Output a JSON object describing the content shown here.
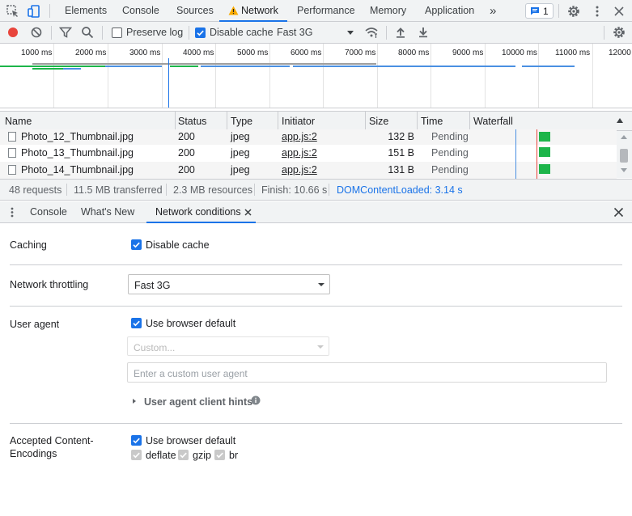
{
  "main_tabs": [
    {
      "label": "Elements"
    },
    {
      "label": "Console"
    },
    {
      "label": "Sources"
    },
    {
      "label": "Network",
      "active": true,
      "warning": true
    },
    {
      "label": "Performance"
    },
    {
      "label": "Memory"
    },
    {
      "label": "Application"
    }
  ],
  "more_tabs_glyph": "»",
  "issues_count": "1",
  "toolbar": {
    "preserve_log_label": "Preserve log",
    "preserve_log_checked": false,
    "disable_cache_label": "Disable cache",
    "disable_cache_checked": true,
    "throttling_value": "Fast 3G"
  },
  "overview": {
    "ticks": [
      "1000 ms",
      "2000 ms",
      "3000 ms",
      "4000 ms",
      "5000 ms",
      "6000 ms",
      "7000 ms",
      "8000 ms",
      "9000 ms",
      "10000 ms",
      "11000 ms",
      "12000"
    ]
  },
  "table": {
    "columns": [
      "Name",
      "Status",
      "Type",
      "Initiator",
      "Size",
      "Time",
      "Waterfall"
    ],
    "sorted_by": "Waterfall",
    "rows": [
      {
        "name": "Photo_12_Thumbnail.jpg",
        "status": "200",
        "type": "jpeg",
        "initiator": "app.js:2",
        "size": "132 B",
        "time": "Pending"
      },
      {
        "name": "Photo_13_Thumbnail.jpg",
        "status": "200",
        "type": "jpeg",
        "initiator": "app.js:2",
        "size": "151 B",
        "time": "Pending"
      },
      {
        "name": "Photo_14_Thumbnail.jpg",
        "status": "200",
        "type": "jpeg",
        "initiator": "app.js:2",
        "size": "131 B",
        "time": "Pending"
      }
    ]
  },
  "summary": {
    "requests": "48 requests",
    "transferred": "11.5 MB transferred",
    "resources": "2.3 MB resources",
    "finish": "Finish: 10.66 s",
    "dom_content_loaded": "DOMContentLoaded: 3.14 s",
    "dcl_color": "#1a73e8"
  },
  "drawer": {
    "tabs": [
      {
        "label": "Console"
      },
      {
        "label": "What's New"
      },
      {
        "label": "Network conditions",
        "active": true,
        "closable": true
      }
    ]
  },
  "network_conditions": {
    "caching_label": "Caching",
    "disable_cache_label": "Disable cache",
    "disable_cache_checked": true,
    "throttling_label": "Network throttling",
    "throttling_value": "Fast 3G",
    "user_agent_label": "User agent",
    "use_browser_default_label": "Use browser default",
    "use_browser_default_checked": true,
    "custom_select_value": "Custom...",
    "custom_ua_placeholder": "Enter a custom user agent",
    "ua_client_hints_label": "User agent client hints",
    "accepted_encodings_label_line1": "Accepted Content-",
    "accepted_encodings_label_line2": "Encodings",
    "encodings_default_label": "Use browser default",
    "encodings_default_checked": true,
    "encodings": [
      {
        "label": "deflate",
        "checked": true
      },
      {
        "label": "gzip",
        "checked": true
      },
      {
        "label": "br",
        "checked": true
      }
    ]
  },
  "colors": {
    "accent": "#1a73e8",
    "record": "#e8453c",
    "warning": "#f9ab00",
    "waterfall_bar": "#1db54a"
  }
}
